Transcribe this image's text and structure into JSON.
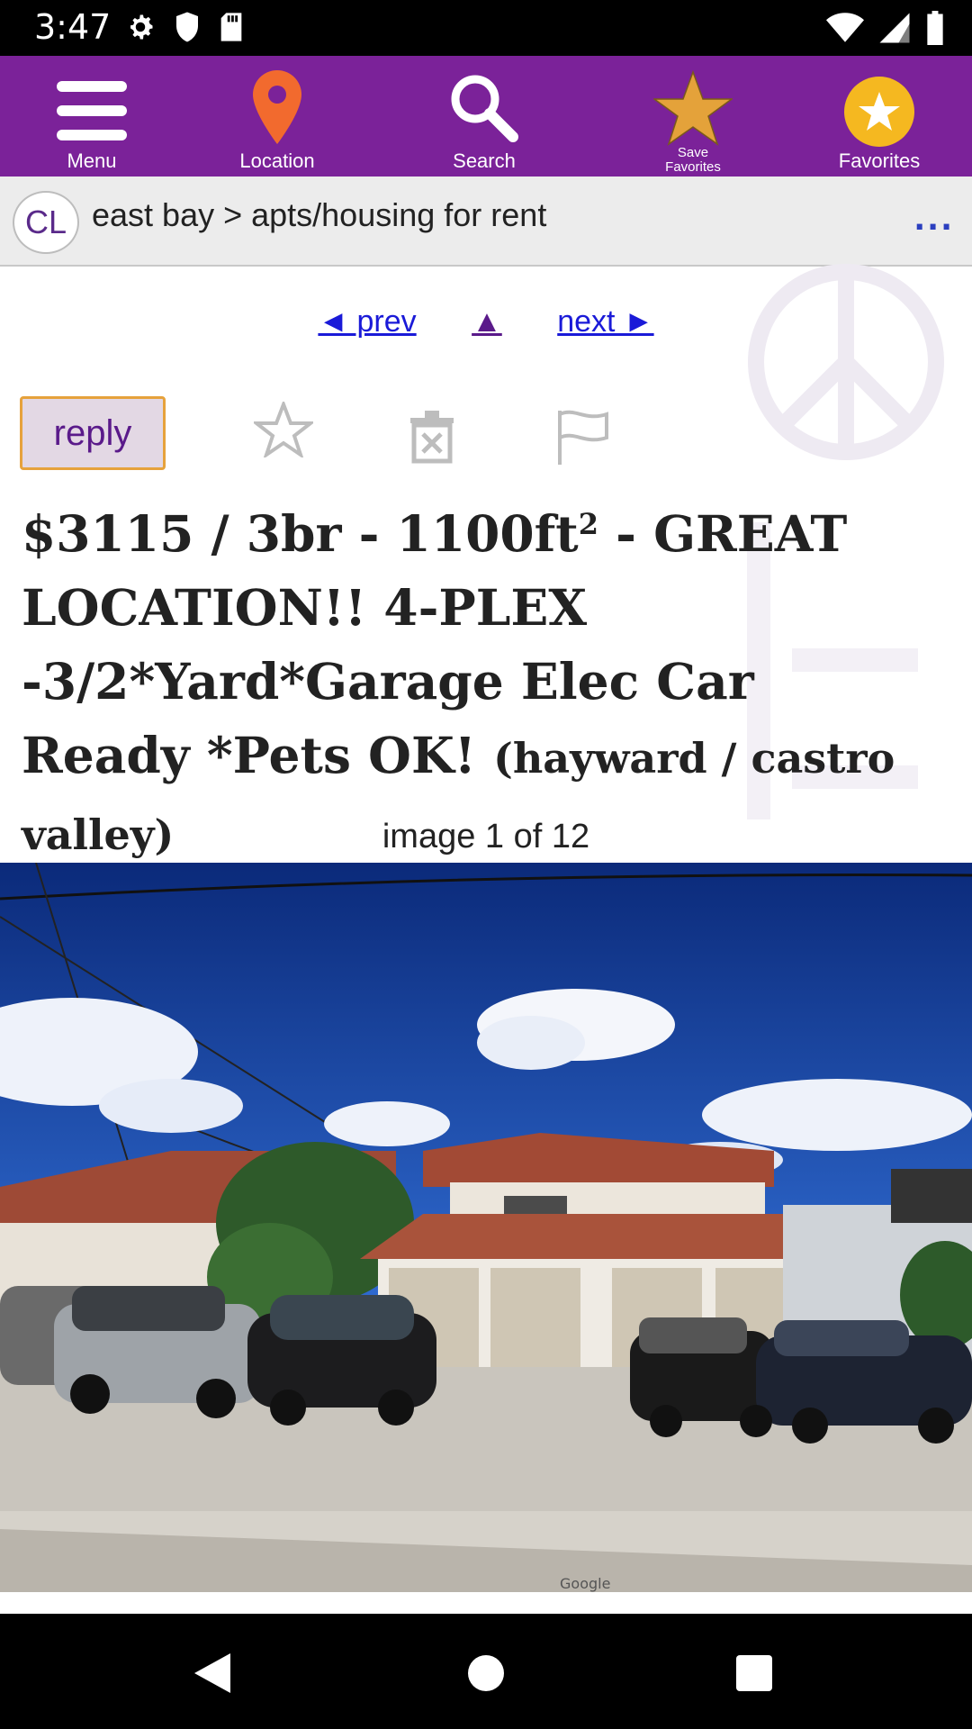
{
  "status_bar": {
    "time": "3:47",
    "left_icons": [
      "gear-icon",
      "shield-icon",
      "sd-card-icon"
    ],
    "right_icons": [
      "wifi-icon",
      "signal-icon",
      "battery-icon"
    ]
  },
  "toolbar": {
    "background": "#7b2299",
    "items": [
      {
        "label": "Menu",
        "icon": "hamburger-menu-icon"
      },
      {
        "label": "Location",
        "icon": "location-pin-icon"
      },
      {
        "label": "Search",
        "icon": "search-icon"
      },
      {
        "label": "Save Favorites",
        "icon": "star-icon"
      },
      {
        "label": "Favorites",
        "icon": "star-circle-icon"
      }
    ]
  },
  "breadcrumb": {
    "badge": "CL",
    "text": "east bay > apts/housing for rent",
    "more": "..."
  },
  "nav": {
    "prev": "◄ prev",
    "up": "▲",
    "next": "next ►"
  },
  "actions": {
    "reply": "reply",
    "icons": [
      "favorite-star-icon",
      "hide-trash-icon",
      "flag-icon"
    ]
  },
  "post": {
    "title_main": "$3115 / 3br - 1100ft",
    "title_sup": "2",
    "title_rest": " - GREAT LOCATION!! 4-PLEX -3/2*Yard*Garage Elec Car Ready *Pets OK!",
    "neighborhood": "(hayward / castro valley)"
  },
  "gallery": {
    "caption": "image 1 of 12",
    "photo_watermark": "Google"
  }
}
